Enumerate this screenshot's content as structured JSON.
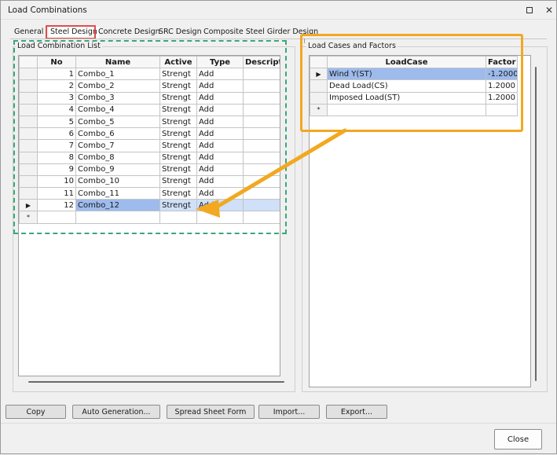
{
  "window": {
    "title": "Load Combinations"
  },
  "tabs": [
    {
      "label": "General"
    },
    {
      "label": "Steel Design"
    },
    {
      "label": "Concrete Design"
    },
    {
      "label": "SRC Design"
    },
    {
      "label": "Composite Steel Girder Design"
    }
  ],
  "left_group": {
    "label": "Load Combination List",
    "columns": [
      "No",
      "Name",
      "Active",
      "Type",
      "Descripti"
    ],
    "rows": [
      {
        "no": "1",
        "name": "Combo_1",
        "active": "Strengt",
        "type": "Add",
        "desc": ""
      },
      {
        "no": "2",
        "name": "Combo_2",
        "active": "Strengt",
        "type": "Add",
        "desc": ""
      },
      {
        "no": "3",
        "name": "Combo_3",
        "active": "Strengt",
        "type": "Add",
        "desc": ""
      },
      {
        "no": "4",
        "name": "Combo_4",
        "active": "Strengt",
        "type": "Add",
        "desc": ""
      },
      {
        "no": "5",
        "name": "Combo_5",
        "active": "Strengt",
        "type": "Add",
        "desc": ""
      },
      {
        "no": "6",
        "name": "Combo_6",
        "active": "Strengt",
        "type": "Add",
        "desc": ""
      },
      {
        "no": "7",
        "name": "Combo_7",
        "active": "Strengt",
        "type": "Add",
        "desc": ""
      },
      {
        "no": "8",
        "name": "Combo_8",
        "active": "Strengt",
        "type": "Add",
        "desc": ""
      },
      {
        "no": "9",
        "name": "Combo_9",
        "active": "Strengt",
        "type": "Add",
        "desc": ""
      },
      {
        "no": "10",
        "name": "Combo_10",
        "active": "Strengt",
        "type": "Add",
        "desc": ""
      },
      {
        "no": "11",
        "name": "Combo_11",
        "active": "Strengt",
        "type": "Add",
        "desc": ""
      },
      {
        "no": "12",
        "name": "Combo_12",
        "active": "Strengt",
        "type": "Add",
        "desc": ""
      }
    ],
    "selected_row": "12",
    "current_row_marker": "▶",
    "new_row_marker": "*"
  },
  "right_group": {
    "label": "Load Cases and Factors",
    "columns": [
      "LoadCase",
      "Factor"
    ],
    "rows": [
      {
        "case": "Wind Y(ST)",
        "factor": "-1.2000"
      },
      {
        "case": "Dead Load(CS)",
        "factor": "1.2000"
      },
      {
        "case": "Imposed Load(ST)",
        "factor": "1.2000"
      }
    ],
    "current_row_marker": "▶",
    "new_row_marker": "*"
  },
  "buttons": {
    "copy": "Copy",
    "auto_generation": "Auto Generation...",
    "spread_sheet_form": "Spread Sheet Form",
    "import": "Import...",
    "export": "Export...",
    "close": "Close"
  },
  "icons": {
    "maximize": "maximize-icon",
    "close": "close-icon",
    "callout_arrow": "arrow-icon"
  },
  "colors": {
    "selection_highlight": "#9dbbed",
    "tab_highlight_border": "#e04d4d",
    "dashed_box": "#3aa87a",
    "orange_box": "#f2a820",
    "arrow": "#f2a820"
  }
}
